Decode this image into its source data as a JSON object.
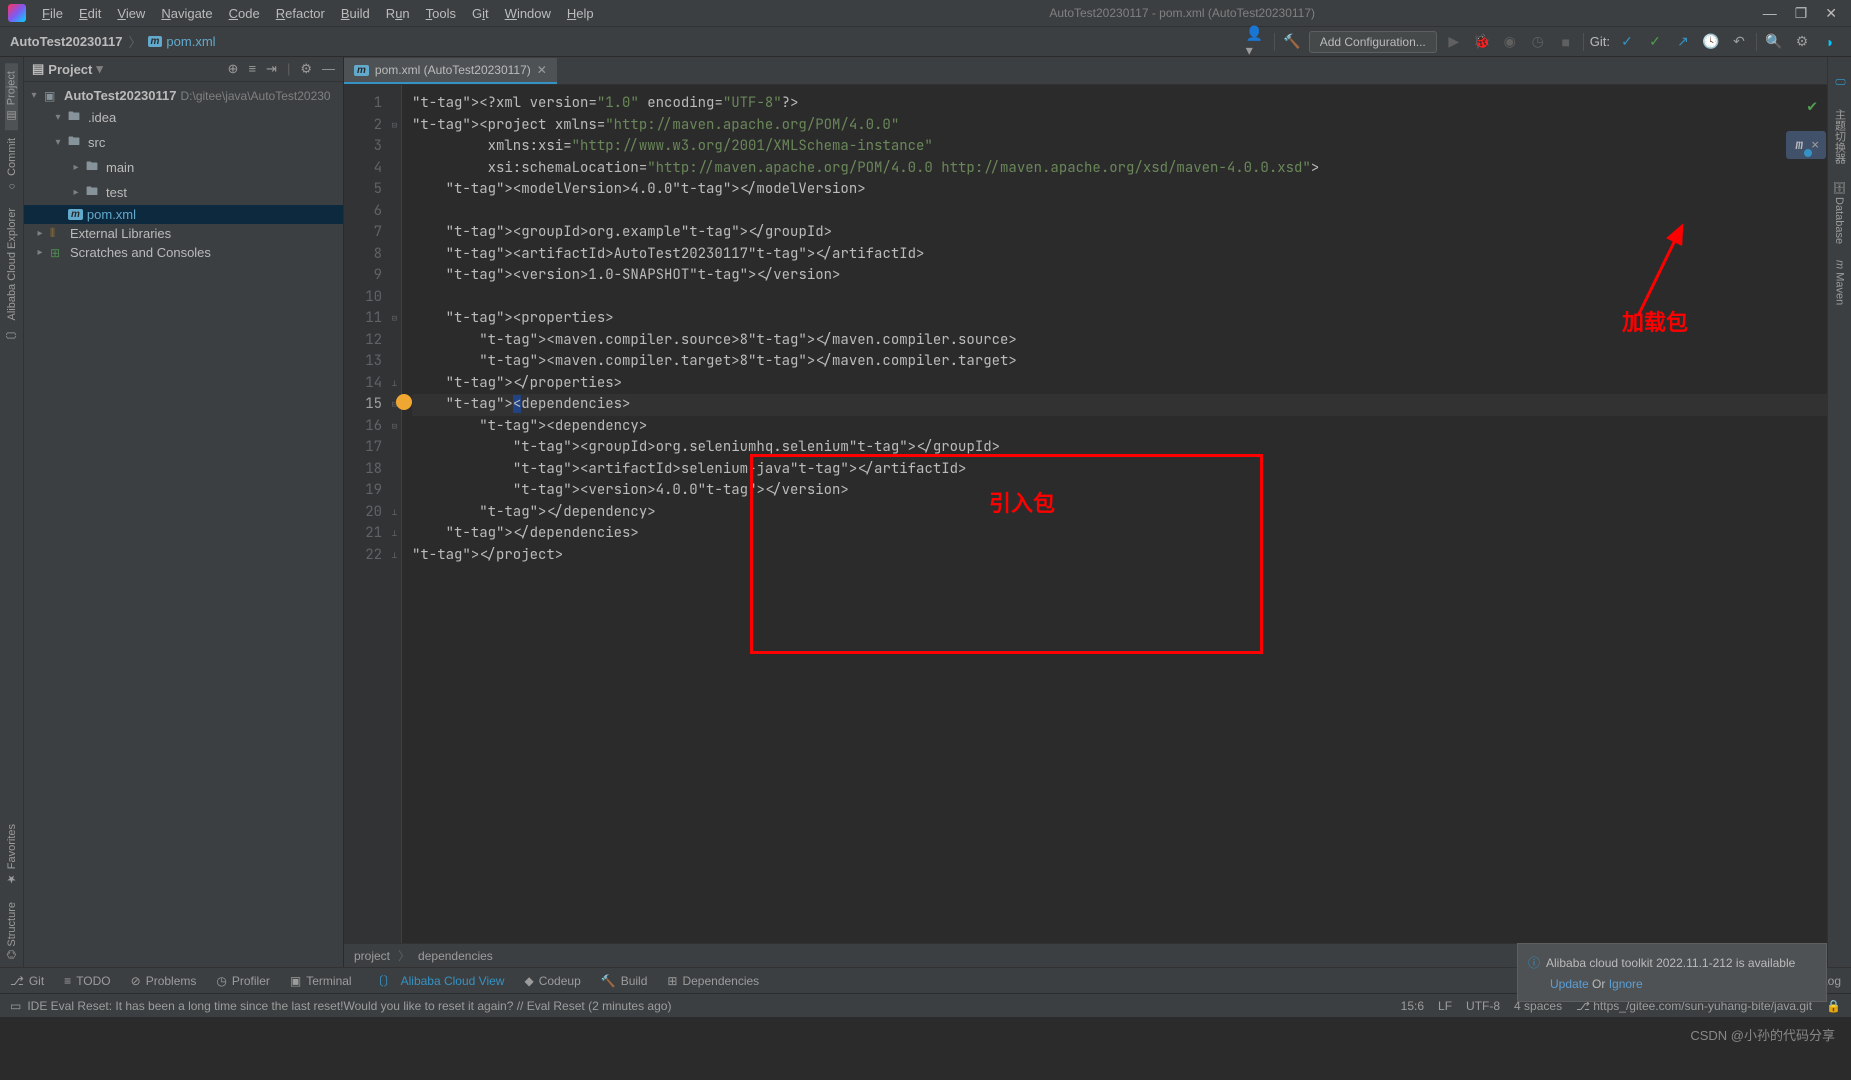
{
  "menu": {
    "items": [
      "File",
      "Edit",
      "View",
      "Navigate",
      "Code",
      "Refactor",
      "Build",
      "Run",
      "Tools",
      "Git",
      "Window",
      "Help"
    ],
    "title": "AutoTest20230117 - pom.xml (AutoTest20230117)"
  },
  "breadcrumb": {
    "root": "AutoTest20230117",
    "file": "pom.xml"
  },
  "toolbar": {
    "add_config": "Add Configuration...",
    "git": "Git:"
  },
  "left_sidebar": {
    "project": "Project",
    "commit": "Commit",
    "alibaba": "Alibaba Cloud Explorer"
  },
  "right_sidebar": {
    "zhushou": "主题切换器",
    "database": "Database",
    "maven": "Maven"
  },
  "project_panel": {
    "title": "Project",
    "root": {
      "name": "AutoTest20230117",
      "path": "D:\\gitee\\java\\AutoTest20230"
    },
    "tree": [
      {
        "indent": 1,
        "arrow": "▾",
        "icon": "folder",
        "label": ".idea"
      },
      {
        "indent": 1,
        "arrow": "▾",
        "icon": "folder",
        "label": "src"
      },
      {
        "indent": 2,
        "arrow": "▸",
        "icon": "folder",
        "label": "main"
      },
      {
        "indent": 2,
        "arrow": "▸",
        "icon": "folder",
        "label": "test"
      },
      {
        "indent": 1,
        "arrow": "",
        "icon": "m",
        "label": "pom.xml",
        "sel": true,
        "blue": true
      },
      {
        "indent": 0,
        "arrow": "▸",
        "icon": "lib",
        "label": "External Libraries"
      },
      {
        "indent": 0,
        "arrow": "▸",
        "icon": "scratch",
        "label": "Scratches and Consoles"
      }
    ]
  },
  "editor_tab": {
    "label": "pom.xml (AutoTest20230117)"
  },
  "overlay": {
    "letter": "m",
    "close": "✕"
  },
  "code": {
    "lines": [
      "<?xml version=\"1.0\" encoding=\"UTF-8\"?>",
      "<project xmlns=\"http://maven.apache.org/POM/4.0.0\"",
      "         xmlns:xsi=\"http://www.w3.org/2001/XMLSchema-instance\"",
      "         xsi:schemaLocation=\"http://maven.apache.org/POM/4.0.0 http://maven.apache.org/xsd/maven-4.0.0.xsd\">",
      "    <modelVersion>4.0.0</modelVersion>",
      "",
      "    <groupId>org.example</groupId>",
      "    <artifactId>AutoTest20230117</artifactId>",
      "    <version>1.0-SNAPSHOT</version>",
      "",
      "    <properties>",
      "        <maven.compiler.source>8</maven.compiler.source>",
      "        <maven.compiler.target>8</maven.compiler.target>",
      "    </properties>",
      "    <dependencies>",
      "        <dependency>",
      "            <groupId>org.seleniumhq.selenium</groupId>",
      "            <artifactId>selenium-java</artifactId>",
      "            <version>4.0.0</version>",
      "        </dependency>",
      "    </dependencies>",
      "</project>"
    ]
  },
  "annotations": {
    "inside": "引入包",
    "load": "加载包"
  },
  "crumb": {
    "a": "project",
    "b": "dependencies"
  },
  "notification": {
    "title": "Alibaba cloud toolkit 2022.11.1-212 is available",
    "update": "Update",
    "or": " Or ",
    "ignore": "Ignore"
  },
  "bottom_tabs": {
    "git": "Git",
    "todo": "TODO",
    "problems": "Problems",
    "profiler": "Profiler",
    "terminal": "Terminal",
    "acv": "Alibaba Cloud View",
    "codeup": "Codeup",
    "build": "Build",
    "deps": "Dependencies",
    "event": "Event Log"
  },
  "status": {
    "msg": "IDE Eval Reset: It has been a long time since the last reset!Would you like to reset it again? // Eval Reset (2 minutes ago)",
    "pos": "15:6",
    "lf": "LF",
    "enc": "UTF-8",
    "spaces": "4 spaces",
    "gitremote": "https_/gitee.com/sun-yuhang-bite/java.git"
  },
  "watermark": "CSDN @小孙的代码分享"
}
